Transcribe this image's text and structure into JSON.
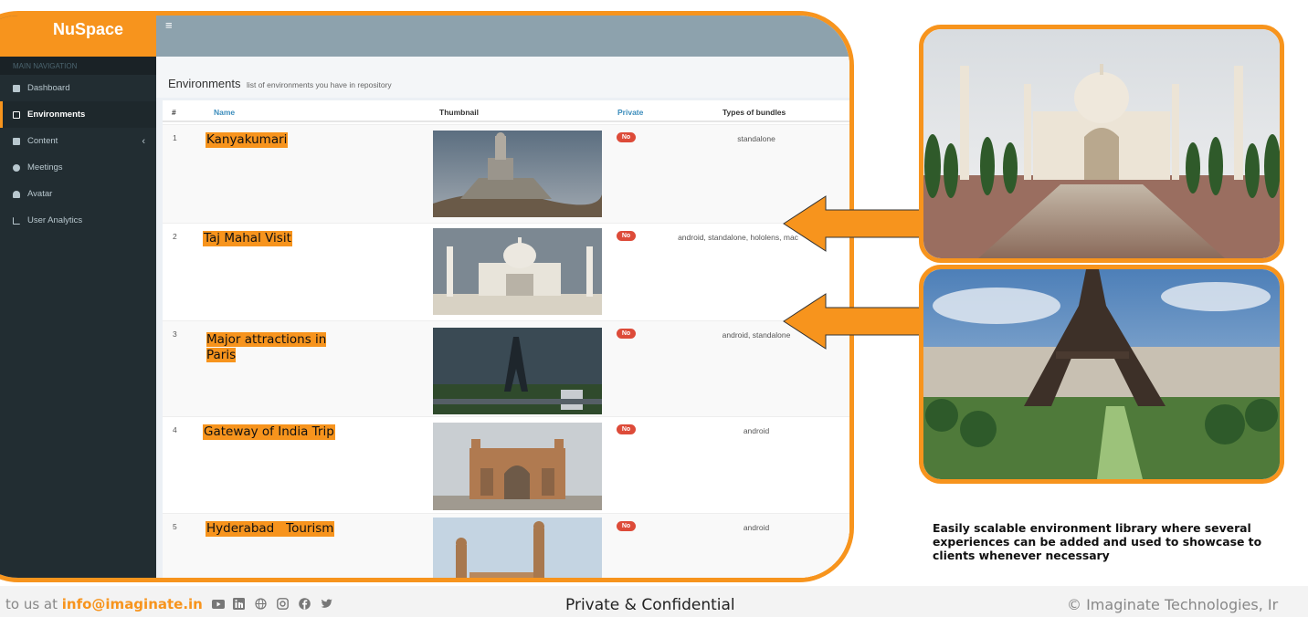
{
  "app": {
    "logo": "NuSpace",
    "nav_header": "MAIN NAVIGATION",
    "menu_icon": "hamburger-icon"
  },
  "sidebar": {
    "items": [
      {
        "label": "Dashboard",
        "icon": "dashboard-icon"
      },
      {
        "label": "Environments",
        "icon": "environments-icon",
        "active": true
      },
      {
        "label": "Content",
        "icon": "folder-icon"
      },
      {
        "label": "Meetings",
        "icon": "meetings-icon"
      },
      {
        "label": "Avatar",
        "icon": "user-icon"
      },
      {
        "label": "User Analytics",
        "icon": "bar-chart-icon"
      }
    ]
  },
  "page": {
    "title": "Environments",
    "subtitle": "list of environments you have in repository"
  },
  "table": {
    "headers": {
      "num": "#",
      "name": "Name",
      "thumbnail": "Thumbnail",
      "private": "Private",
      "types": "Types of bundles"
    },
    "rows": [
      {
        "num": "1",
        "name": "Kanyakumari",
        "private": "No",
        "types": "standalone"
      },
      {
        "num": "2",
        "name": "Taj Mahal Visit",
        "private": "No",
        "types": "android, standalone, hololens, mac"
      },
      {
        "num": "3",
        "name": "Major attractions in Paris",
        "private": "No",
        "types": "android, standalone"
      },
      {
        "num": "4",
        "name": "Gateway of India Trip",
        "private": "No",
        "types": "android"
      },
      {
        "num": "5",
        "name": "Hyderabad   Tourism",
        "private": "No",
        "types": "android"
      }
    ]
  },
  "caption": "Easily scalable environment library where several experiences can be added and used to showcase to clients whenever necessary",
  "footer": {
    "contact_prefix": "to us at ",
    "email": "info@imaginate.in",
    "social_icons": [
      "youtube-icon",
      "linkedin-icon",
      "globe-icon",
      "instagram-icon",
      "facebook-icon",
      "twitter-icon"
    ],
    "confidential": "Private & Confidential",
    "copyright": "© Imaginate Technologies, Ir"
  },
  "colors": {
    "accent": "#f7941d",
    "sidebar": "#222d32",
    "badge": "#dd4b39",
    "header": "#8da2ad"
  }
}
